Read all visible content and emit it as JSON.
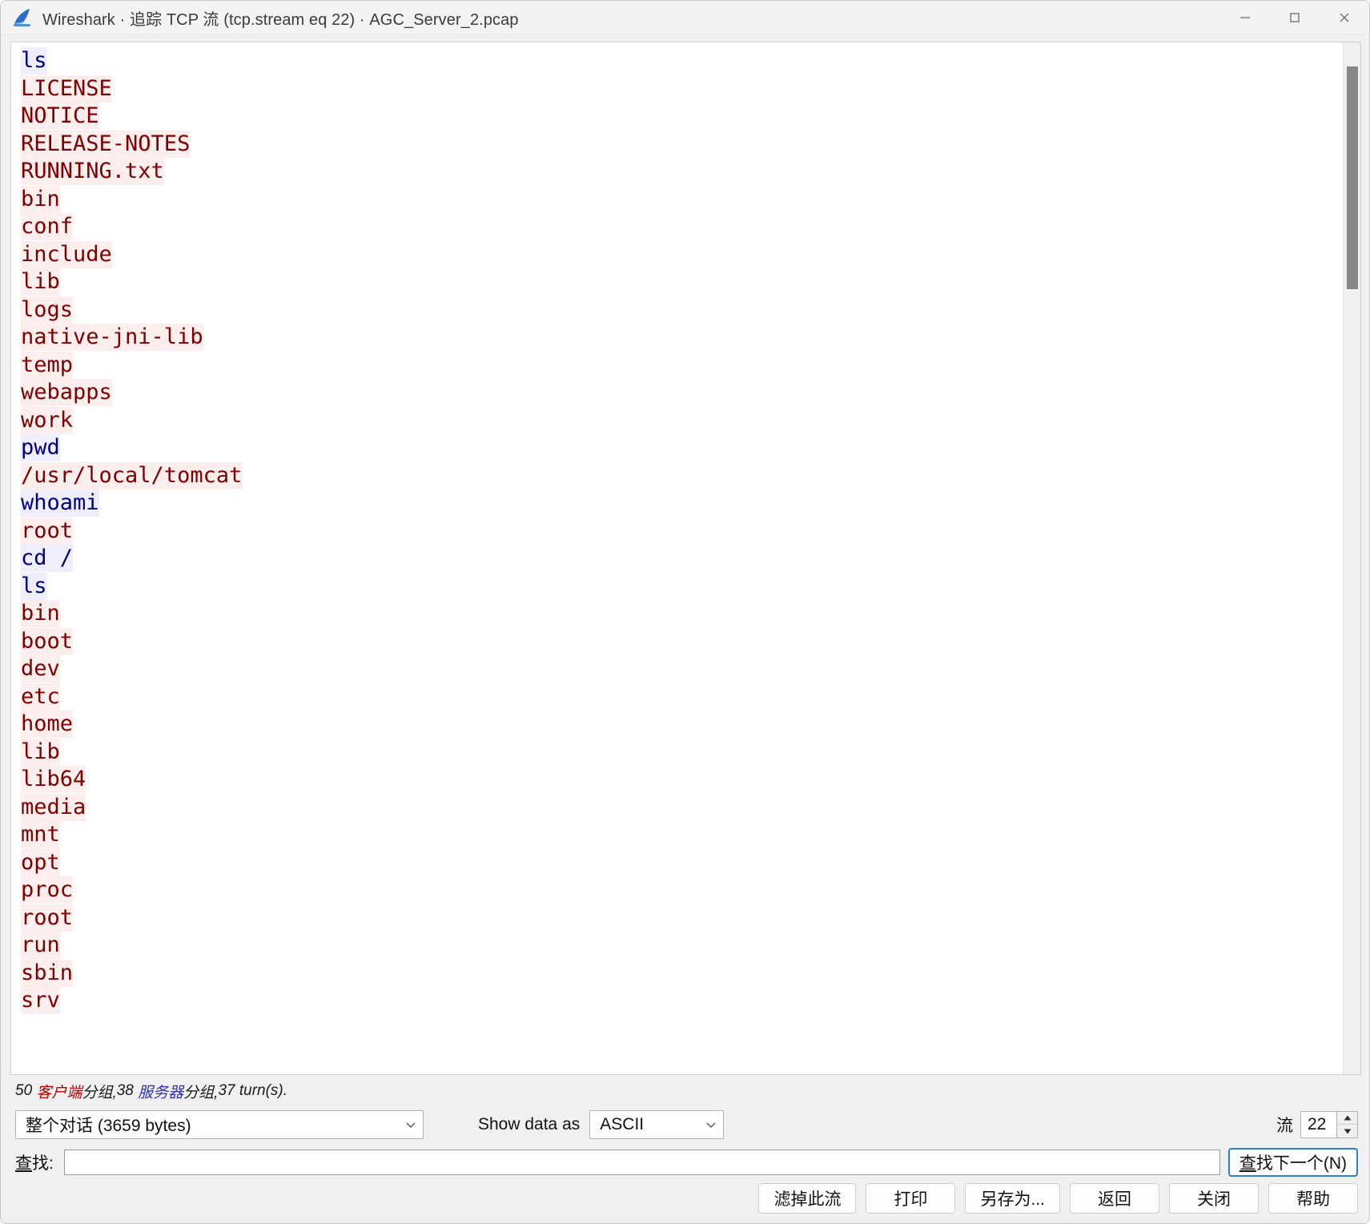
{
  "window": {
    "title": "Wireshark · 追踪 TCP 流 (tcp.stream eq 22) · AGC_Server_2.pcap",
    "app_icon": "wireshark-shark-fin-icon",
    "minimize_label": "minimize-icon",
    "maximize_label": "maximize-icon",
    "close_label": "close-icon"
  },
  "colors": {
    "client_text": "#00007f",
    "client_bg": "#eeeeff",
    "server_text": "#7f0000",
    "server_bg": "#fdeeee",
    "focus_border": "#2b7fd4",
    "status_client": "#c00000",
    "status_server": "#3030c0"
  },
  "stream": {
    "lines": [
      {
        "dir": "client",
        "text": "ls"
      },
      {
        "dir": "server",
        "text": "LICENSE"
      },
      {
        "dir": "server",
        "text": "NOTICE"
      },
      {
        "dir": "server",
        "text": "RELEASE-NOTES"
      },
      {
        "dir": "server",
        "text": "RUNNING.txt"
      },
      {
        "dir": "server",
        "text": "bin"
      },
      {
        "dir": "server",
        "text": "conf"
      },
      {
        "dir": "server",
        "text": "include"
      },
      {
        "dir": "server",
        "text": "lib"
      },
      {
        "dir": "server",
        "text": "logs"
      },
      {
        "dir": "server",
        "text": "native-jni-lib"
      },
      {
        "dir": "server",
        "text": "temp"
      },
      {
        "dir": "server",
        "text": "webapps"
      },
      {
        "dir": "server",
        "text": "work"
      },
      {
        "dir": "client",
        "text": "pwd"
      },
      {
        "dir": "server",
        "text": "/usr/local/tomcat"
      },
      {
        "dir": "client",
        "text": "whoami"
      },
      {
        "dir": "server",
        "text": "root"
      },
      {
        "dir": "client",
        "text": "cd /"
      },
      {
        "dir": "client",
        "text": "ls"
      },
      {
        "dir": "server",
        "text": "bin"
      },
      {
        "dir": "server",
        "text": "boot"
      },
      {
        "dir": "server",
        "text": "dev"
      },
      {
        "dir": "server",
        "text": "etc"
      },
      {
        "dir": "server",
        "text": "home"
      },
      {
        "dir": "server",
        "text": "lib"
      },
      {
        "dir": "server",
        "text": "lib64"
      },
      {
        "dir": "server",
        "text": "media"
      },
      {
        "dir": "server",
        "text": "mnt"
      },
      {
        "dir": "server",
        "text": "opt"
      },
      {
        "dir": "server",
        "text": "proc"
      },
      {
        "dir": "server",
        "text": "root"
      },
      {
        "dir": "server",
        "text": "run"
      },
      {
        "dir": "server",
        "text": "sbin"
      },
      {
        "dir": "server",
        "text": "srv"
      }
    ]
  },
  "status": {
    "count_client": "50",
    "label_client": "客户端",
    "mid_client": " 分组,  ",
    "count_server": "38",
    "label_server": "服务器",
    "mid_server": " 分组,  ",
    "turns": "37 turn(s).",
    "prefix": ""
  },
  "controls": {
    "conversation_value": "整个对话  (3659 bytes)",
    "show_data_as_label": "Show data as",
    "show_data_as_value": "ASCII",
    "stream_label": "流",
    "stream_value": "22",
    "chevron_icon": "chevron-down-icon",
    "spin_up_icon": "spinner-up-icon",
    "spin_down_icon": "spinner-down-icon"
  },
  "find": {
    "label_mnemonic": "查",
    "label_rest": "找:",
    "input_value": "",
    "input_placeholder": "",
    "button_text": "查找下一个",
    "button_mnemonic": "(N)"
  },
  "buttons": [
    {
      "name": "filter-out-this-stream-button",
      "label": "滤掉此流"
    },
    {
      "name": "print-button",
      "label": "打印"
    },
    {
      "name": "save-as-button",
      "label": "另存为..."
    },
    {
      "name": "back-button",
      "label": "返回"
    },
    {
      "name": "close-button",
      "label": "关闭"
    },
    {
      "name": "help-button",
      "label": "帮助"
    }
  ]
}
